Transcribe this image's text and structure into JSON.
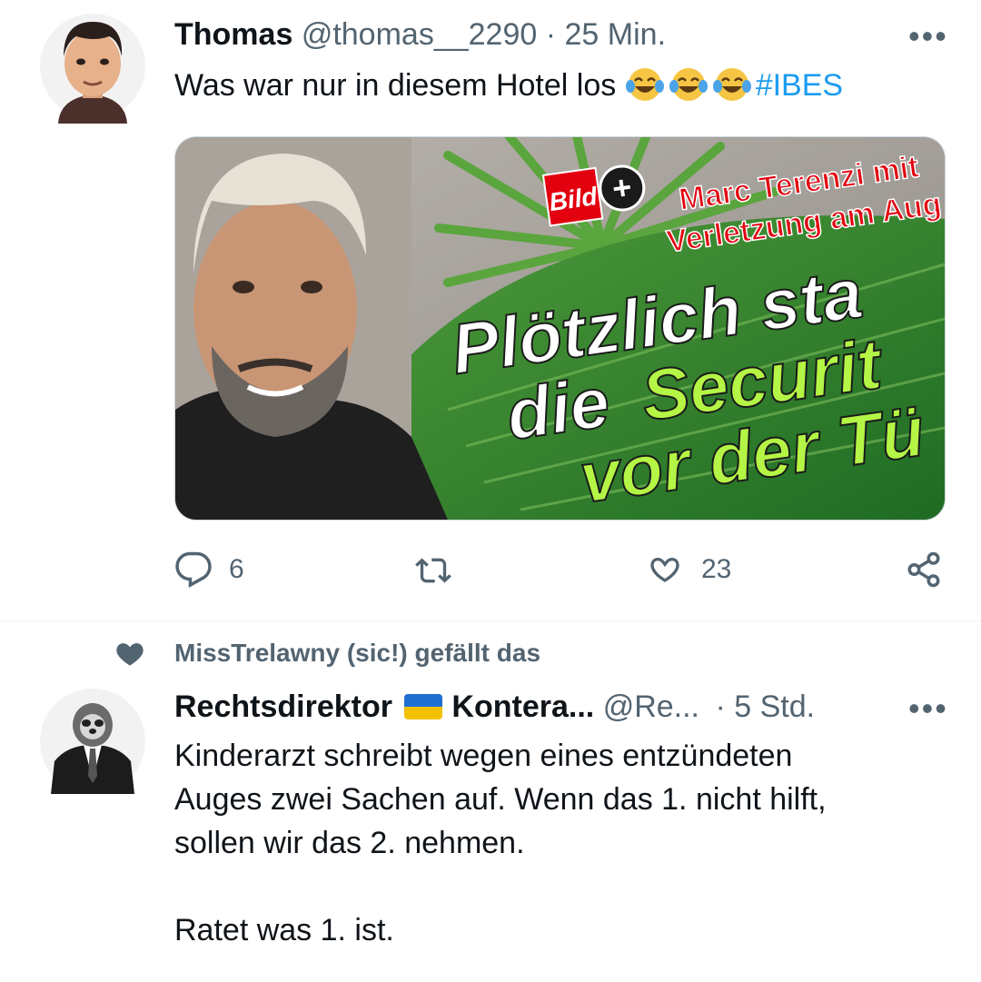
{
  "tweet1": {
    "name": "Thomas",
    "handle": "@thomas__2290",
    "separator": "·",
    "time": "25 Min.",
    "more": "•••",
    "text": "Was war nur in diesem Hotel los",
    "emoji_names": [
      "face-with-tears-of-joy-icon",
      "face-with-tears-of-joy-icon",
      "face-with-tears-of-joy-icon"
    ],
    "hashtag": "#IBES",
    "media": {
      "logo": "Bild",
      "plus": "+",
      "headline_line1": "Marc Terenzi mit",
      "headline_line2": "Verletzung am Aug",
      "big_line1": "Plötzlich sta",
      "big_line2a": "die",
      "big_line2b": "Securit",
      "big_line3": "vor der Tü"
    },
    "actions": {
      "replies": "6",
      "retweets": "",
      "likes": "23"
    }
  },
  "liked_by": "MissTrelawny (sic!) gefällt das",
  "tweet2": {
    "name": "Rechtsdirektor",
    "name2": "Kontera...",
    "handle": "@Re...",
    "separator": "·",
    "time": "5 Std.",
    "more": "•••",
    "line1": "Kinderarzt schreibt wegen eines entzündeten",
    "line2": "Auges zwei Sachen auf. Wenn das 1. nicht hilft,",
    "line3": "sollen wir das 2. nehmen.",
    "line4": "Ratet was 1. ist."
  },
  "colors": {
    "text": "#0f1419",
    "secondary": "#536471",
    "link": "#1d9bf0",
    "bild_red": "#e3000f",
    "headline_green": "#b4f545"
  }
}
